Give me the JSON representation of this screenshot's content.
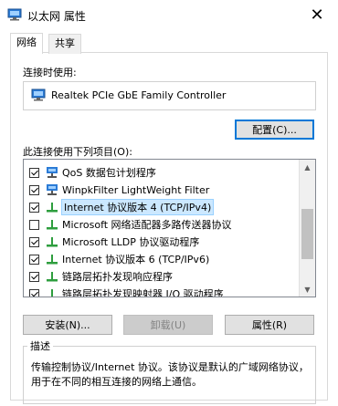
{
  "window": {
    "title": "以太网 属性",
    "close_glyph": "✕"
  },
  "tabs": [
    {
      "label": "网络",
      "active": true
    },
    {
      "label": "共享",
      "active": false
    }
  ],
  "connect_using": {
    "label": "连接时使用:",
    "adapter": "Realtek PCIe GbE Family Controller",
    "configure_button": "配置(C)..."
  },
  "items_section": {
    "label": "此连接使用下列项目(O):",
    "items": [
      {
        "label": "QoS 数据包计划程序",
        "checked": true,
        "icon": "qos-icon"
      },
      {
        "label": "WinpkFilter LightWeight Filter",
        "checked": true,
        "icon": "network-component-icon"
      },
      {
        "label": "Internet 协议版本 4 (TCP/IPv4)",
        "checked": true,
        "icon": "protocol-icon",
        "selected": true
      },
      {
        "label": "Microsoft 网络适配器多路传送器协议",
        "checked": false,
        "icon": "protocol-icon"
      },
      {
        "label": "Microsoft LLDP 协议驱动程序",
        "checked": true,
        "icon": "protocol-icon"
      },
      {
        "label": "Internet 协议版本 6 (TCP/IPv6)",
        "checked": true,
        "icon": "protocol-icon"
      },
      {
        "label": "链路层拓扑发现响应程序",
        "checked": true,
        "icon": "protocol-icon"
      },
      {
        "label": "链路层拓扑发现映射器 I/O 驱动程序",
        "checked": true,
        "icon": "protocol-icon"
      }
    ]
  },
  "buttons": {
    "install": "安装(N)...",
    "uninstall": "卸载(U)",
    "properties": "属性(R)"
  },
  "description": {
    "title": "描述",
    "text": "传输控制协议/Internet 协议。该协议是默认的广域网络协议，用于在不同的相互连接的网络上通信。"
  },
  "colors": {
    "accent": "#0078d7",
    "selection": "#cce8ff"
  }
}
